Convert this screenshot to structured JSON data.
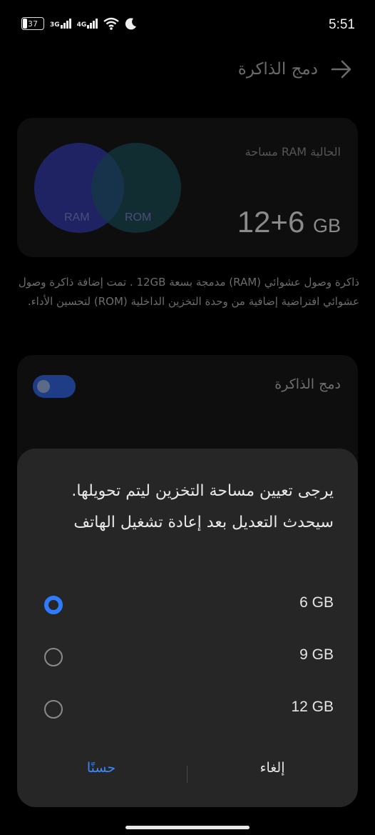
{
  "status_bar": {
    "battery": "37",
    "network1": "3G",
    "network2": "4G",
    "time": "5:51",
    "icons": [
      "battery-icon",
      "signal-icon",
      "signal-icon",
      "wifi-icon",
      "moon-icon"
    ]
  },
  "header": {
    "title": "دمج الذاكرة",
    "back_icon": "arrow-icon"
  },
  "ram_card": {
    "ram_label": "مساحة RAM الحالية",
    "ram_value": "12+6",
    "ram_unit": "GB",
    "circle_ram_label": "RAM",
    "circle_rom_label": "ROM",
    "colors": {
      "ram": "#21266e",
      "rom": "#143a40"
    }
  },
  "description": "ذاكرة وصول عشوائي (RAM) مدمجة بسعة 12GB . تمت إضافة ذاكرة وصول عشوائي افتراضية إضافية من وحدة التخزين الداخلية (ROM) لتحسين الأداء.",
  "settings": {
    "toggle_label": "دمج الذاكرة",
    "toggle_on": true
  },
  "dialog": {
    "message": "يرجى تعيين مساحة التخزين ليتم تحويلها. سيحدث التعديل بعد إعادة تشغيل الهاتف",
    "options": [
      {
        "label": "6 GB",
        "selected": true
      },
      {
        "label": "9 GB",
        "selected": false
      },
      {
        "label": "12 GB",
        "selected": false
      }
    ],
    "ok_label": "حسنًا",
    "cancel_label": "إلغاء",
    "accent": "#2f7bff"
  }
}
